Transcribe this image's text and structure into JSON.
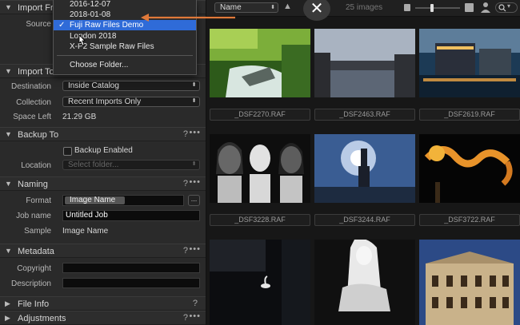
{
  "left_panel": {
    "import_from": {
      "title": "Import Fr",
      "source_label": "Source"
    },
    "import_to": {
      "title": "Import To",
      "destination_label": "Destination",
      "destination_value": "Inside Catalog",
      "collection_label": "Collection",
      "collection_value": "Recent Imports Only",
      "space_label": "Space Left",
      "space_value": "21.29 GB"
    },
    "backup_to": {
      "title": "Backup To",
      "help": "?",
      "more": "•••",
      "checkbox_label": "Backup Enabled",
      "location_label": "Location",
      "location_placeholder": "Select folder..."
    },
    "naming": {
      "title": "Naming",
      "help": "?",
      "more": "•••",
      "format_label": "Format",
      "format_token": "Image Name",
      "format_more": "...",
      "jobname_label": "Job name",
      "jobname_value": "Untitled Job",
      "sample_label": "Sample",
      "sample_value": "Image Name"
    },
    "metadata": {
      "title": "Metadata",
      "help": "?",
      "more": "•••",
      "copyright_label": "Copyright",
      "description_label": "Description"
    },
    "file_info": {
      "title": "File Info",
      "help": "?"
    },
    "adjustments": {
      "title": "Adjustments",
      "help": "?",
      "more": "•••"
    }
  },
  "dropdown": {
    "items": [
      {
        "label": "2016-12-07"
      },
      {
        "label": "2018-01-08"
      },
      {
        "label": "Fuji Raw Files Demo",
        "selected": true
      },
      {
        "label": "London 2018"
      },
      {
        "label": "X-P2 Sample Raw Files"
      }
    ],
    "choose_folder": "Choose Folder..."
  },
  "toolbar": {
    "sort_value": "Name",
    "count_text": "25 images"
  },
  "grid": {
    "captions": [
      "_DSF2270.RAF",
      "_DSF2463.RAF",
      "_DSF2619.RAF",
      "_DSF3228.RAF",
      "_DSF3244.RAF",
      "_DSF3722.RAF"
    ]
  },
  "colors": {
    "accent": "#2f6bd8",
    "arrow": "#e0793a"
  }
}
